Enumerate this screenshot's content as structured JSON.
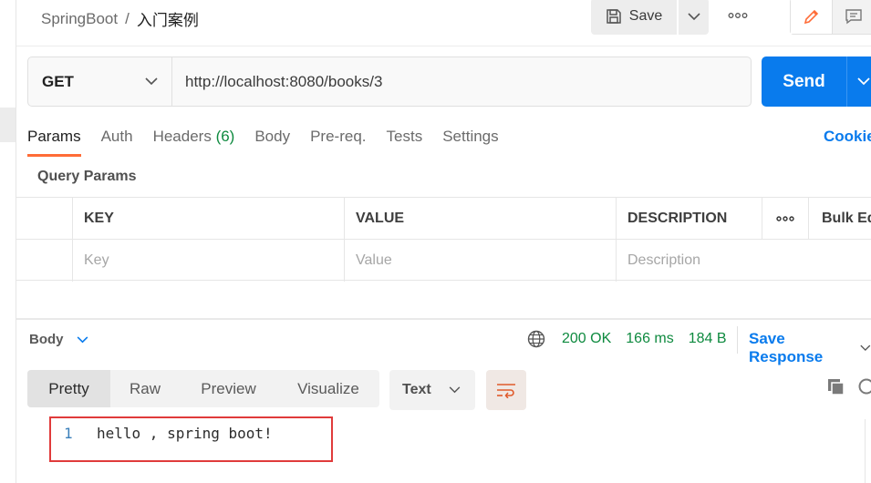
{
  "header": {
    "collection": "SpringBoot",
    "separator": "/",
    "request_name": "入门案例",
    "save_label": "Save"
  },
  "request": {
    "method": "GET",
    "url": "http://localhost:8080/books/3",
    "send_label": "Send"
  },
  "tabs": [
    {
      "label": "Params"
    },
    {
      "label": "Auth"
    },
    {
      "label": "Headers",
      "count": "(6)"
    },
    {
      "label": "Body"
    },
    {
      "label": "Pre-req."
    },
    {
      "label": "Tests"
    },
    {
      "label": "Settings"
    }
  ],
  "cookies_label": "Cookie",
  "query_params": {
    "title": "Query Params",
    "columns": [
      "KEY",
      "VALUE",
      "DESCRIPTION"
    ],
    "bulk_edit": "Bulk Ed",
    "placeholders": {
      "key": "Key",
      "value": "Value",
      "description": "Description"
    }
  },
  "response": {
    "body_label": "Body",
    "status": "200 OK",
    "time": "166 ms",
    "size": "184 B",
    "save_response": "Save Response",
    "views": [
      "Pretty",
      "Raw",
      "Preview",
      "Visualize"
    ],
    "format": "Text",
    "lines": [
      {
        "n": "1",
        "text": "hello , spring boot!"
      }
    ]
  },
  "colors": {
    "accent_orange": "#ff6c37",
    "send_blue": "#097bed",
    "status_green": "#0e8a3f",
    "highlight_red": "#e03b3b"
  },
  "icons": [
    "save-icon",
    "chevron-down-icon",
    "more-icon",
    "edit-icon",
    "comment-icon",
    "globe-icon",
    "wrap-lines-icon",
    "copy-icon",
    "search-icon"
  ]
}
